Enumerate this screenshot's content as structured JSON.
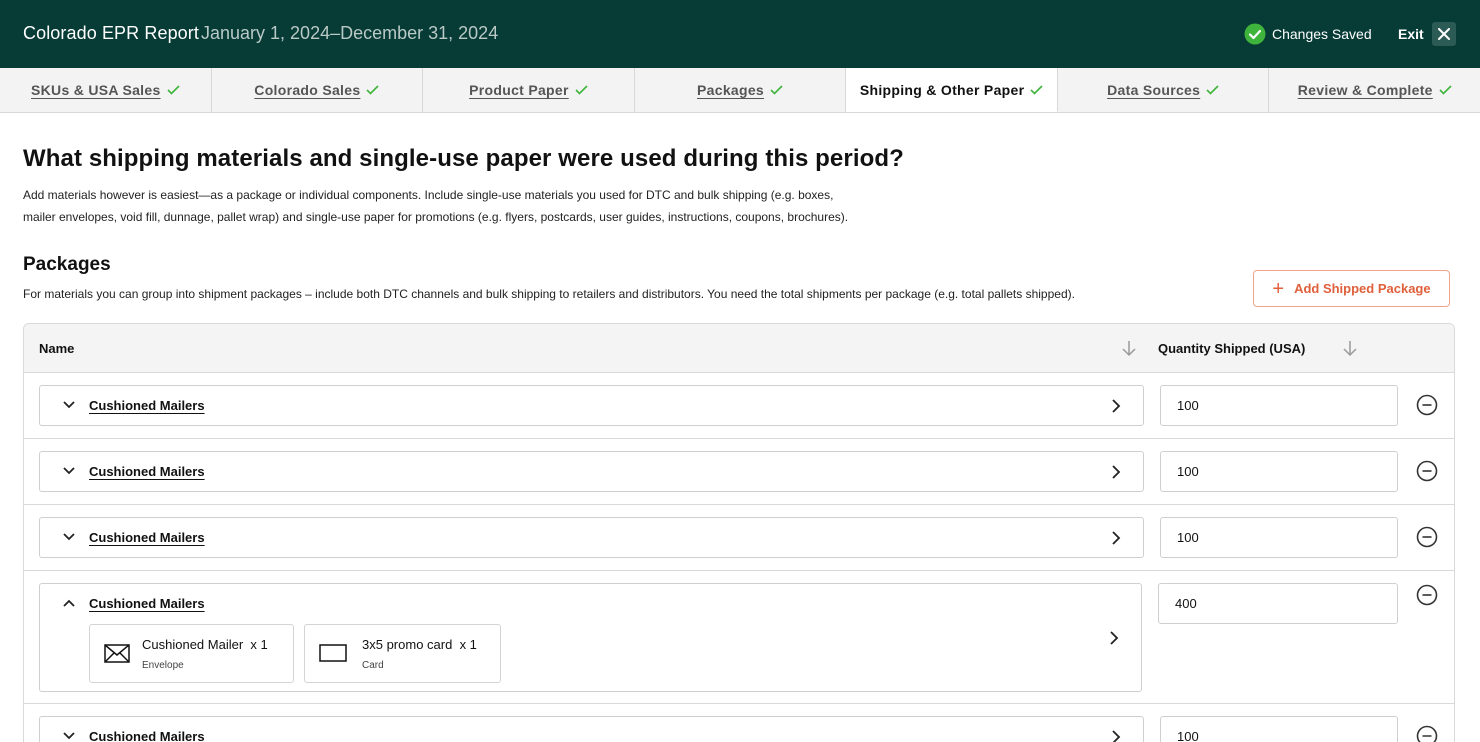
{
  "header": {
    "title": "Colorado EPR Report",
    "date_range": "January 1, 2024–December 31, 2024",
    "saved_status": "Changes Saved",
    "exit_label": "Exit"
  },
  "tabs": [
    {
      "label": "SKUs & USA Sales",
      "completed": true
    },
    {
      "label": "Colorado Sales",
      "completed": true
    },
    {
      "label": "Product Paper",
      "completed": true
    },
    {
      "label": "Packages",
      "completed": true
    },
    {
      "label": "Shipping & Other Paper",
      "completed": true,
      "active": true
    },
    {
      "label": "Data Sources",
      "completed": true
    },
    {
      "label": "Review & Complete",
      "completed": true
    }
  ],
  "main": {
    "title": "What shipping materials and single-use paper were used during this period?",
    "description_line1": "Add materials however is easiest—as a package or individual components. Include single-use materials you used for DTC and bulk shipping (e.g. boxes,",
    "description_line2": "mailer envelopes, void fill, dunnage, pallet wrap) and single-use paper for promotions (e.g. flyers, postcards, user guides, instructions, coupons, brochures)."
  },
  "packages": {
    "title": "Packages",
    "description": "For materials you can group into shipment packages – include both DTC channels and bulk shipping to retailers and distributors. You need the total shipments per package (e.g. total pallets shipped).",
    "add_button": "Add Shipped Package",
    "columns": {
      "name": "Name",
      "quantity": "Quantity Shipped (USA)"
    },
    "rows": [
      {
        "name": "Cushioned Mailers",
        "quantity": "100",
        "expanded": false
      },
      {
        "name": "Cushioned Mailers",
        "quantity": "100",
        "expanded": false
      },
      {
        "name": "Cushioned Mailers",
        "quantity": "100",
        "expanded": false
      },
      {
        "name": "Cushioned Mailers",
        "quantity": "400",
        "expanded": true,
        "components": [
          {
            "name": "Cushioned Mailer",
            "count": "x 1",
            "type": "Envelope",
            "icon": "envelope-icon"
          },
          {
            "name": "3x5 promo card",
            "count": "x 1",
            "type": "Card",
            "icon": "card-icon"
          }
        ]
      },
      {
        "name": "Cushioned Mailers",
        "quantity": "100",
        "expanded": false
      }
    ]
  },
  "colors": {
    "header_bg": "#063b36",
    "success": "#3fb43c",
    "accent": "#e0603b"
  }
}
